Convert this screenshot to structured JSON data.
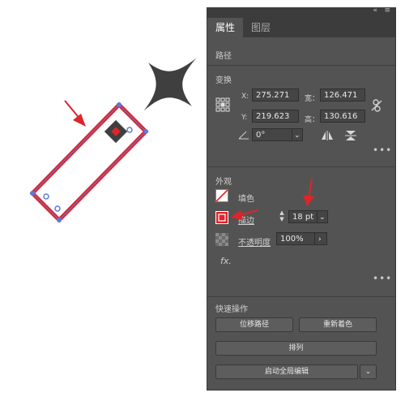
{
  "panel": {
    "tabs": [
      {
        "label": "属性"
      },
      {
        "label": "图层"
      }
    ],
    "sections": {
      "path": {
        "label": "路径"
      },
      "transform": {
        "label": "变换",
        "x_label": "X:",
        "x_value": "275.271",
        "y_label": "Y:",
        "y_value": "219.623",
        "w_label": "宽：",
        "w_value": "126.471",
        "h_label": "高：",
        "h_value": "130.616",
        "angle_value": "0°"
      },
      "appearance": {
        "label": "外观",
        "fill_label": "填色",
        "stroke_label": "描边",
        "stroke_weight": "18 pt",
        "opacity_label": "不透明度",
        "opacity_value": "100%",
        "fx_label": "fx."
      },
      "quick_actions": {
        "label": "快速操作",
        "offset_path": "位移路径",
        "recolor": "重新着色",
        "arrange": "排列",
        "global_edit": "启动全局编辑"
      }
    }
  },
  "colors": {
    "panel_bg": "#535353",
    "accent_red": "#e0242b",
    "selection_blue": "#5b7bd8",
    "star": "#3f3f3f"
  }
}
